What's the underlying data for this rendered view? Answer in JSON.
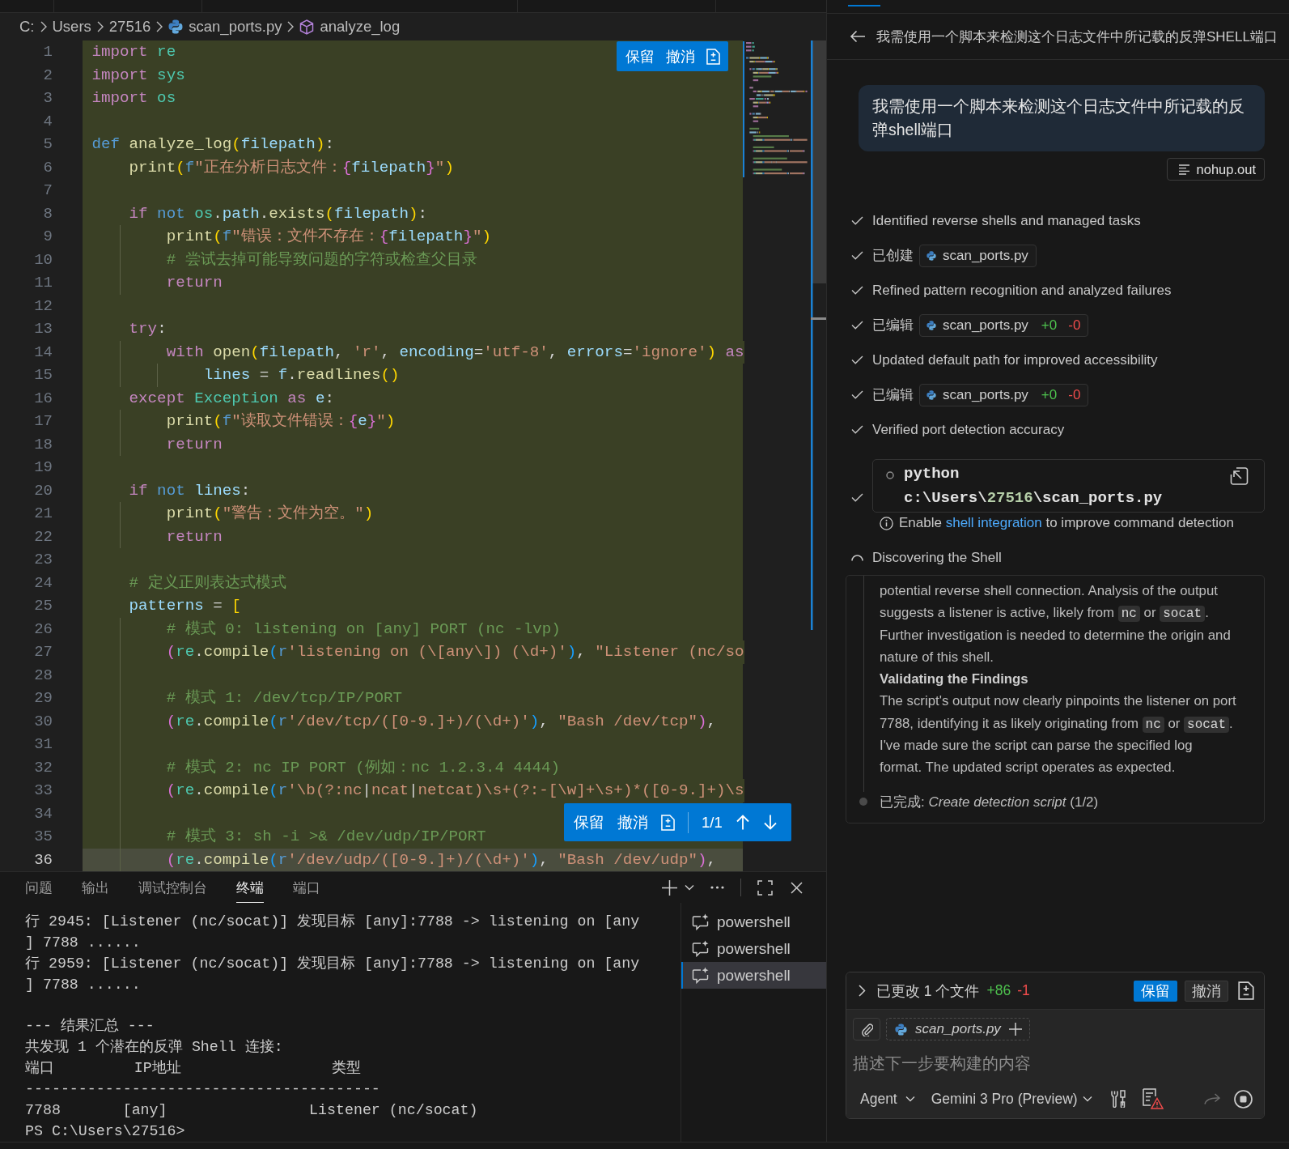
{
  "breadcrumb": [
    {
      "kind": "folder",
      "text": "C:"
    },
    {
      "kind": "folder",
      "text": "Users"
    },
    {
      "kind": "folder",
      "text": "27516"
    },
    {
      "kind": "file",
      "text": "scan_ports.py"
    },
    {
      "kind": "symbol",
      "text": "analyze_log"
    }
  ],
  "editor": {
    "lines": [
      {
        "number": "1",
        "added": true,
        "current": false,
        "tokens": [
          {
            "kind": "keyword",
            "text": "import"
          },
          {
            "kind": "type",
            "text": " re"
          }
        ]
      },
      {
        "number": "2",
        "added": true,
        "current": false,
        "tokens": [
          {
            "kind": "keyword",
            "text": "import"
          },
          {
            "kind": "type",
            "text": " sys"
          }
        ]
      },
      {
        "number": "3",
        "added": true,
        "current": false,
        "tokens": [
          {
            "kind": "keyword",
            "text": "import"
          },
          {
            "kind": "type",
            "text": " os"
          }
        ]
      },
      {
        "number": "4",
        "added": true,
        "current": false
      },
      {
        "number": "5",
        "added": true,
        "current": false,
        "tokens": [
          {
            "kind": "storage",
            "text": "def"
          },
          {
            "kind": "function",
            "text": " analyze_log"
          },
          {
            "kind": "bracket1",
            "text": "("
          },
          {
            "kind": "variable",
            "text": "filepath"
          },
          {
            "kind": "bracket1",
            "text": ")"
          },
          {
            "kind": "plain",
            "text": ":"
          }
        ]
      },
      {
        "number": "6",
        "added": true,
        "current": false,
        "tokens": [
          {
            "kind": "function",
            "text": "    print"
          },
          {
            "kind": "bracket1",
            "text": "("
          },
          {
            "kind": "storage",
            "text": "f"
          },
          {
            "kind": "string",
            "text": "\"正在分析日志文件："
          },
          {
            "kind": "bracket2",
            "text": "{"
          },
          {
            "kind": "variable",
            "text": "filepath"
          },
          {
            "kind": "bracket2",
            "text": "}"
          },
          {
            "kind": "string",
            "text": "\""
          },
          {
            "kind": "bracket1",
            "text": ")"
          }
        ]
      },
      {
        "number": "7",
        "added": true,
        "current": false
      },
      {
        "number": "8",
        "added": true,
        "current": false,
        "tokens": [
          {
            "kind": "keyword",
            "text": "    if"
          },
          {
            "kind": "storage",
            "text": " not"
          },
          {
            "kind": "type",
            "text": " os"
          },
          {
            "kind": "plain",
            "text": "."
          },
          {
            "kind": "variable",
            "text": "path"
          },
          {
            "kind": "plain",
            "text": "."
          },
          {
            "kind": "function",
            "text": "exists"
          },
          {
            "kind": "bracket1",
            "text": "("
          },
          {
            "kind": "variable",
            "text": "filepath"
          },
          {
            "kind": "bracket1",
            "text": ")"
          },
          {
            "kind": "plain",
            "text": ":"
          }
        ]
      },
      {
        "number": "9",
        "added": true,
        "current": false,
        "tokens": [
          {
            "kind": "function",
            "text": "        print"
          },
          {
            "kind": "bracket1",
            "text": "("
          },
          {
            "kind": "storage",
            "text": "f"
          },
          {
            "kind": "string",
            "text": "\"错误：文件不存在："
          },
          {
            "kind": "bracket2",
            "text": "{"
          },
          {
            "kind": "variable",
            "text": "filepath"
          },
          {
            "kind": "bracket2",
            "text": "}"
          },
          {
            "kind": "string",
            "text": "\""
          },
          {
            "kind": "bracket1",
            "text": ")"
          }
        ]
      },
      {
        "number": "10",
        "added": true,
        "current": false,
        "tokens": [
          {
            "kind": "comment",
            "text": "        # 尝试去掉可能导致问题的字符或检查父目录"
          }
        ]
      },
      {
        "number": "11",
        "added": true,
        "current": false,
        "tokens": [
          {
            "kind": "keyword",
            "text": "        return"
          }
        ]
      },
      {
        "number": "12",
        "added": true,
        "current": false
      },
      {
        "number": "13",
        "added": true,
        "current": false,
        "tokens": [
          {
            "kind": "keyword",
            "text": "    try"
          },
          {
            "kind": "plain",
            "text": ":"
          }
        ]
      },
      {
        "number": "14",
        "added": true,
        "current": false,
        "tokens": [
          {
            "kind": "keyword",
            "text": "        with"
          },
          {
            "kind": "function",
            "text": " open"
          },
          {
            "kind": "bracket1",
            "text": "("
          },
          {
            "kind": "variable",
            "text": "filepath"
          },
          {
            "kind": "plain",
            "text": ", "
          },
          {
            "kind": "string",
            "text": "'r'"
          },
          {
            "kind": "plain",
            "text": ", "
          },
          {
            "kind": "variable",
            "text": "encoding"
          },
          {
            "kind": "plain",
            "text": "="
          },
          {
            "kind": "string",
            "text": "'utf-8'"
          },
          {
            "kind": "plain",
            "text": ", "
          },
          {
            "kind": "variable",
            "text": "errors"
          },
          {
            "kind": "plain",
            "text": "="
          },
          {
            "kind": "string",
            "text": "'ignore'"
          },
          {
            "kind": "bracket1",
            "text": ")"
          },
          {
            "kind": "keyword",
            "text": " as"
          }
        ]
      },
      {
        "number": "15",
        "added": true,
        "current": false,
        "tokens": [
          {
            "kind": "variable",
            "text": "            lines"
          },
          {
            "kind": "plain",
            "text": " = "
          },
          {
            "kind": "variable",
            "text": "f"
          },
          {
            "kind": "plain",
            "text": "."
          },
          {
            "kind": "function",
            "text": "readlines"
          },
          {
            "kind": "bracket1",
            "text": "()"
          }
        ]
      },
      {
        "number": "16",
        "added": true,
        "current": false,
        "tokens": [
          {
            "kind": "keyword",
            "text": "    except"
          },
          {
            "kind": "type",
            "text": " Exception"
          },
          {
            "kind": "keyword",
            "text": " as"
          },
          {
            "kind": "variable",
            "text": " e"
          },
          {
            "kind": "plain",
            "text": ":"
          }
        ]
      },
      {
        "number": "17",
        "added": true,
        "current": false,
        "tokens": [
          {
            "kind": "function",
            "text": "        print"
          },
          {
            "kind": "bracket1",
            "text": "("
          },
          {
            "kind": "storage",
            "text": "f"
          },
          {
            "kind": "string",
            "text": "\"读取文件错误："
          },
          {
            "kind": "bracket2",
            "text": "{"
          },
          {
            "kind": "variable",
            "text": "e"
          },
          {
            "kind": "bracket2",
            "text": "}"
          },
          {
            "kind": "string",
            "text": "\""
          },
          {
            "kind": "bracket1",
            "text": ")"
          }
        ]
      },
      {
        "number": "18",
        "added": true,
        "current": false,
        "tokens": [
          {
            "kind": "keyword",
            "text": "        return"
          }
        ]
      },
      {
        "number": "19",
        "added": true,
        "current": false
      },
      {
        "number": "20",
        "added": true,
        "current": false,
        "tokens": [
          {
            "kind": "keyword",
            "text": "    if"
          },
          {
            "kind": "storage",
            "text": " not"
          },
          {
            "kind": "variable",
            "text": " lines"
          },
          {
            "kind": "plain",
            "text": ":"
          }
        ]
      },
      {
        "number": "21",
        "added": true,
        "current": false,
        "tokens": [
          {
            "kind": "function",
            "text": "        print"
          },
          {
            "kind": "bracket1",
            "text": "("
          },
          {
            "kind": "string",
            "text": "\"警告：文件为空。\""
          },
          {
            "kind": "bracket1",
            "text": ")"
          }
        ]
      },
      {
        "number": "22",
        "added": true,
        "current": false,
        "tokens": [
          {
            "kind": "keyword",
            "text": "        return"
          }
        ]
      },
      {
        "number": "23",
        "added": true,
        "current": false
      },
      {
        "number": "24",
        "added": true,
        "current": false,
        "tokens": [
          {
            "kind": "comment",
            "text": "    # 定义正则表达式模式"
          }
        ]
      },
      {
        "number": "25",
        "added": true,
        "current": false,
        "tokens": [
          {
            "kind": "variable",
            "text": "    patterns"
          },
          {
            "kind": "plain",
            "text": " = "
          },
          {
            "kind": "bracket1",
            "text": "["
          }
        ]
      },
      {
        "number": "26",
        "added": true,
        "current": false,
        "tokens": [
          {
            "kind": "comment",
            "text": "        # 模式 0: listening on [any] PORT (nc -lvp)"
          }
        ]
      },
      {
        "number": "27",
        "added": true,
        "current": false,
        "tokens": [
          {
            "kind": "bracket2",
            "text": "        ("
          },
          {
            "kind": "type",
            "text": "re"
          },
          {
            "kind": "plain",
            "text": "."
          },
          {
            "kind": "function",
            "text": "compile"
          },
          {
            "kind": "bracket3",
            "text": "("
          },
          {
            "kind": "storage",
            "text": "r"
          },
          {
            "kind": "string",
            "text": "'listening on (\\[any\\]) (\\d+)'"
          },
          {
            "kind": "bracket3",
            "text": ")"
          },
          {
            "kind": "plain",
            "text": ", "
          },
          {
            "kind": "string",
            "text": "\"Listener (nc/so"
          }
        ]
      },
      {
        "number": "28",
        "added": true,
        "current": false
      },
      {
        "number": "29",
        "added": true,
        "current": false,
        "tokens": [
          {
            "kind": "comment",
            "text": "        # 模式 1: /dev/tcp/IP/PORT"
          }
        ]
      },
      {
        "number": "30",
        "added": true,
        "current": false,
        "tokens": [
          {
            "kind": "bracket2",
            "text": "        ("
          },
          {
            "kind": "type",
            "text": "re"
          },
          {
            "kind": "plain",
            "text": "."
          },
          {
            "kind": "function",
            "text": "compile"
          },
          {
            "kind": "bracket3",
            "text": "("
          },
          {
            "kind": "storage",
            "text": "r"
          },
          {
            "kind": "string",
            "text": "'/dev/tcp/([0-9.]+)/(\\d+)'"
          },
          {
            "kind": "bracket3",
            "text": ")"
          },
          {
            "kind": "plain",
            "text": ", "
          },
          {
            "kind": "string",
            "text": "\"Bash /dev/tcp\""
          },
          {
            "kind": "bracket2",
            "text": ")"
          },
          {
            "kind": "plain",
            "text": ","
          }
        ]
      },
      {
        "number": "31",
        "added": true,
        "current": false
      },
      {
        "number": "32",
        "added": true,
        "current": false,
        "tokens": [
          {
            "kind": "comment",
            "text": "        # 模式 2: nc IP PORT (例如：nc 1.2.3.4 4444)"
          }
        ]
      },
      {
        "number": "33",
        "added": true,
        "current": false,
        "tokens": [
          {
            "kind": "bracket2",
            "text": "        ("
          },
          {
            "kind": "type",
            "text": "re"
          },
          {
            "kind": "plain",
            "text": "."
          },
          {
            "kind": "function",
            "text": "compile"
          },
          {
            "kind": "bracket3",
            "text": "("
          },
          {
            "kind": "storage",
            "text": "r"
          },
          {
            "kind": "string",
            "text": "'\\b(?:nc"
          },
          {
            "kind": "plain",
            "text": "|"
          },
          {
            "kind": "string",
            "text": "ncat"
          },
          {
            "kind": "plain",
            "text": "|"
          },
          {
            "kind": "string",
            "text": "netcat)\\s+(?:-[\\w]+\\s+)*([0-9.]+)\\s"
          }
        ]
      },
      {
        "number": "34",
        "added": true,
        "current": false
      },
      {
        "number": "35",
        "added": true,
        "current": false,
        "tokens": [
          {
            "kind": "comment",
            "text": "        # 模式 3: sh -i >& /dev/udp/IP/PORT"
          }
        ]
      },
      {
        "number": "36",
        "added": true,
        "current": true,
        "tokens": [
          {
            "kind": "bracket2",
            "text": "        ("
          },
          {
            "kind": "type",
            "text": "re"
          },
          {
            "kind": "plain",
            "text": "."
          },
          {
            "kind": "function",
            "text": "compile"
          },
          {
            "kind": "bracket3",
            "text": "("
          },
          {
            "kind": "storage",
            "text": "r"
          },
          {
            "kind": "string",
            "text": "'/dev/udp/([0-9.]+)/(\\d+)'"
          },
          {
            "kind": "bracket3",
            "text": ")"
          },
          {
            "kind": "plain",
            "text": ", "
          },
          {
            "kind": "string",
            "text": "\"Bash /dev/udp\""
          },
          {
            "kind": "bracket2",
            "text": ")"
          },
          {
            "kind": "plain",
            "text": ","
          }
        ]
      }
    ],
    "top_actions": {
      "keep": "保留",
      "undo": "撤消"
    },
    "change_toolbar": {
      "keep": "保留",
      "undo": "撤消",
      "counter": "1/1"
    }
  },
  "panel": {
    "tabs": [
      {
        "label": "问题",
        "selected": false
      },
      {
        "label": "输出",
        "selected": false
      },
      {
        "label": "调试控制台",
        "selected": false
      },
      {
        "label": "终端",
        "selected": true
      },
      {
        "label": "端口",
        "selected": false
      }
    ],
    "terminal": {
      "lines": [
        {
          "kind": "output",
          "text": "行 2945: [Listener (nc/socat)] 发现目标 [any]:7788 -> listening on [any"
        },
        {
          "kind": "output",
          "text": "] 7788 ......"
        },
        {
          "kind": "output",
          "text": "行 2959: [Listener (nc/socat)] 发现目标 [any]:7788 -> listening on [any"
        },
        {
          "kind": "output",
          "text": "] 7788 ......"
        },
        {
          "kind": "blank"
        },
        {
          "kind": "output",
          "text": "--- 结果汇总 ---"
        },
        {
          "kind": "output",
          "text": "共发现 1 个潜在的反弹 Shell 连接:"
        },
        {
          "kind": "output",
          "text": "端口         IP地址                 类型"
        },
        {
          "kind": "output",
          "text": "----------------------------------------"
        },
        {
          "kind": "output",
          "text": "7788       [any]                Listener (nc/socat)"
        },
        {
          "kind": "output",
          "text": "PS C:\\Users\\27516>"
        }
      ],
      "sessions": [
        {
          "label": "powershell",
          "selected": false
        },
        {
          "label": "powershell",
          "selected": false
        },
        {
          "label": "powershell",
          "selected": true
        }
      ]
    }
  },
  "chat": {
    "title": "我需使用一个脚本来检测这个日志文件中所记载的反弹SHELL端口",
    "user_message": "我需使用一个脚本来检测这个日志文件中所记载的反弹shell端口",
    "attachment": "nohup.out",
    "steps": [
      {
        "kind": "text",
        "done": true,
        "text": "Identified reverse shells and managed tasks"
      },
      {
        "kind": "file",
        "done": true,
        "action": "已创建",
        "file": "scan_ports.py"
      },
      {
        "kind": "text",
        "done": true,
        "text": "Refined pattern recognition and analyzed failures"
      },
      {
        "kind": "file",
        "done": true,
        "action": "已编辑",
        "file": "scan_ports.py",
        "added": "+0",
        "removed": "-0"
      },
      {
        "kind": "text",
        "done": true,
        "text": "Updated default path for improved accessibility"
      },
      {
        "kind": "file",
        "done": true,
        "action": "已编辑",
        "file": "scan_ports.py",
        "added": "+0",
        "removed": "-0"
      },
      {
        "kind": "text",
        "done": true,
        "text": "Verified port detection accuracy"
      },
      {
        "kind": "command",
        "done": true,
        "lines": [
          [
            {
              "kind": "plain",
              "text": "python"
            }
          ],
          [
            {
              "kind": "plain",
              "text": "c:\\Users\\"
            },
            {
              "kind": "number",
              "text": "27516"
            },
            {
              "kind": "plain",
              "text": "\\scan_ports.py"
            }
          ]
        ],
        "note": {
          "before": "Enable ",
          "link": "shell integration",
          "after": " to improve command detection"
        }
      },
      {
        "kind": "text",
        "done": false,
        "text": "Discovering the Shell"
      }
    ],
    "thinking": {
      "paragraphs": [
        {
          "kind": "body",
          "segments": [
            {
              "kind": "text",
              "text": "potential reverse shell connection. Analysis of the output suggests a listener is active, likely from "
            },
            {
              "kind": "code",
              "text": "nc"
            },
            {
              "kind": "text",
              "text": " or "
            },
            {
              "kind": "code",
              "text": "socat"
            },
            {
              "kind": "text",
              "text": ". Further investigation is needed to determine the origin and nature of this shell."
            }
          ]
        },
        {
          "kind": "heading",
          "segments": [
            {
              "kind": "text",
              "text": "Validating the Findings"
            }
          ]
        },
        {
          "kind": "body",
          "segments": [
            {
              "kind": "text",
              "text": "The script's output now clearly pinpoints the listener on port 7788, identifying it as likely originating from "
            },
            {
              "kind": "code",
              "text": "nc"
            },
            {
              "kind": "text",
              "text": " or "
            },
            {
              "kind": "code",
              "text": "socat"
            },
            {
              "kind": "text",
              "text": ". I've made sure the script can parse the specified log format. The updated script operates as expected."
            }
          ]
        }
      ],
      "status": "已完成: *Create detection script* (1/2)"
    },
    "changes": {
      "expanded": false,
      "summary": "已更改 1 个文件",
      "added": "+86",
      "removed": "-1",
      "keep": "保留",
      "undo": "撤消"
    },
    "composer": {
      "context_file": "scan_ports.py",
      "placeholder": "描述下一步要构建的内容",
      "mode": "Agent",
      "model": "Gemini 3 Pro (Preview)"
    }
  }
}
